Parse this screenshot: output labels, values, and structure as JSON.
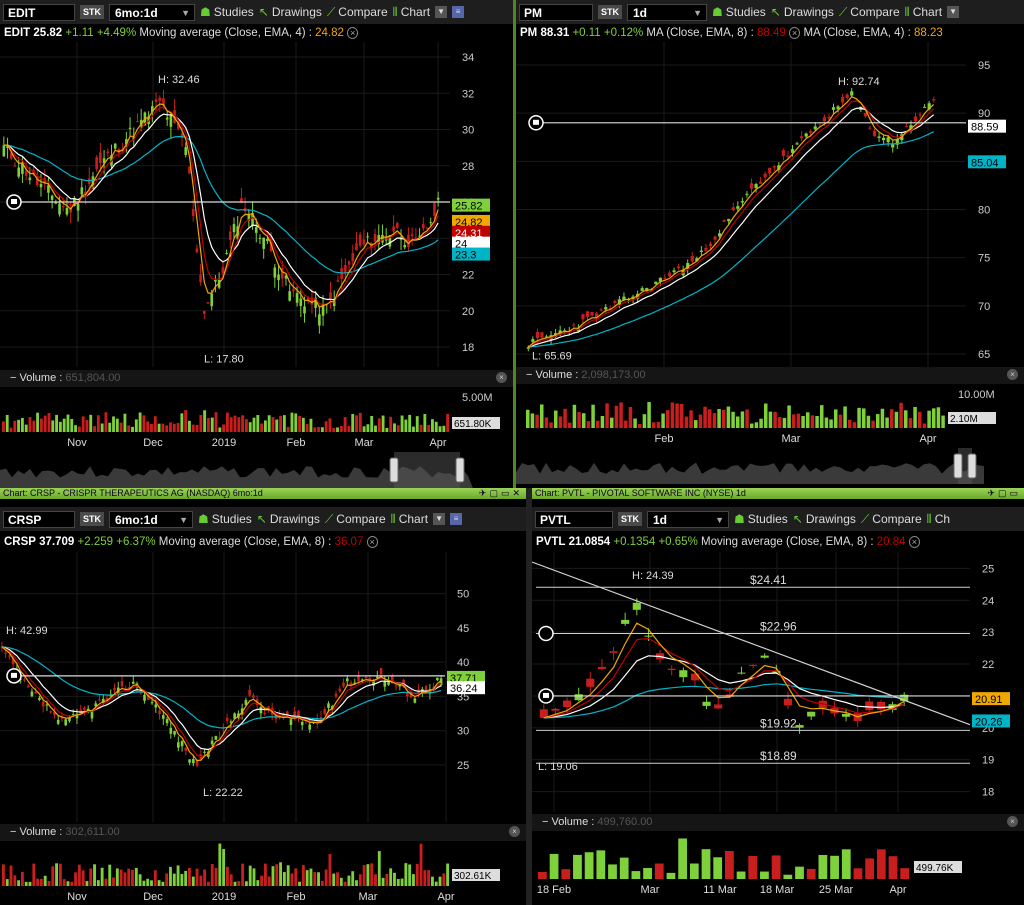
{
  "toolbar_labels": {
    "studies": "Studies",
    "drawings": "Drawings",
    "compare": "Compare",
    "chart": "Chart",
    "chart_short": "Ch",
    "stk": "STK",
    "volume": "Volume"
  },
  "panes": [
    {
      "symbol": "EDIT",
      "period": "6mo:1d",
      "title": "",
      "info": {
        "symbol": "EDIT",
        "price": "25.82",
        "change": "+1.11",
        "pct": "+4.49%",
        "study": "Moving average (Close, EMA, 4) :",
        "study_val": "24.82"
      },
      "yticks": [
        "34",
        "32",
        "30",
        "28",
        "26",
        "24",
        "22",
        "20",
        "18"
      ],
      "xticks": [
        "Nov",
        "Dec",
        "2019",
        "Feb",
        "Mar",
        "Apr"
      ],
      "high_label": "H: 32.46",
      "low_label": "L: 17.80",
      "price_tags": [
        {
          "text": "25.82",
          "color": "#7fd13b",
          "fg": "#000"
        },
        {
          "text": "24.82",
          "color": "#f0a800",
          "fg": "#000"
        },
        {
          "text": "24.31",
          "color": "#c00000",
          "fg": "#fff"
        },
        {
          "text": "24",
          "color": "#ffffff",
          "fg": "#000"
        },
        {
          "text": "23.3",
          "color": "#00b4c8",
          "fg": "#000"
        }
      ],
      "volume_value": "651,804.00",
      "vol_ticks": [
        "5.00M"
      ],
      "vol_tag": "651.80K"
    },
    {
      "symbol": "PM",
      "period": "1d",
      "title": "",
      "info": {
        "symbol": "PM",
        "price": "88.31",
        "change": "+0.11",
        "pct": "+0.12%",
        "study": "MA (Close, EMA, 8) :",
        "study_val": "88.49",
        "study2": "MA (Close, EMA, 4) :",
        "study2_val": "88.23"
      },
      "yticks": [
        "95",
        "90",
        "85",
        "80",
        "75",
        "70",
        "65"
      ],
      "xticks": [
        "Feb",
        "Mar",
        "Apr"
      ],
      "high_label": "H: 92.74",
      "low_label": "L: 65.69",
      "price_tags": [
        {
          "text": "88.59",
          "color": "#ffffff",
          "fg": "#000"
        },
        {
          "text": "85.04",
          "color": "#00b4c8",
          "fg": "#000"
        }
      ],
      "volume_value": "2,098,173.00",
      "vol_ticks": [
        "10.00M"
      ],
      "vol_tag": "2.10M"
    },
    {
      "symbol": "CRSP",
      "period": "6mo:1d",
      "title": "Chart: CRSP - CRISPR THERAPEUTICS AG (NASDAQ) 6mo:1d",
      "info": {
        "symbol": "CRSP",
        "price": "37.709",
        "change": "+2.259",
        "pct": "+6.37%",
        "study": "Moving average (Close, EMA, 8) :",
        "study_val": "36.07"
      },
      "yticks": [
        "50",
        "45",
        "40",
        "35",
        "30",
        "25"
      ],
      "xticks": [
        "Nov",
        "Dec",
        "2019",
        "Feb",
        "Mar",
        "Apr"
      ],
      "high_label": "H: 42.99",
      "low_label": "L: 22.22",
      "price_tags": [
        {
          "text": "37.71",
          "color": "#7fd13b",
          "fg": "#000"
        },
        {
          "text": "36.24",
          "color": "#ffffff",
          "fg": "#000"
        }
      ],
      "volume_value": "302,611.00",
      "vol_ticks": [],
      "vol_tag": "302.61K"
    },
    {
      "symbol": "PVTL",
      "period": "1d",
      "title": "Chart: PVTL - PIVOTAL SOFTWARE INC (NYSE) 1d",
      "info": {
        "symbol": "PVTL",
        "price": "21.0854",
        "change": "+0.1354",
        "pct": "+0.65%",
        "study": "Moving average (Close, EMA, 8) :",
        "study_val": "20.84"
      },
      "yticks": [
        "25",
        "24",
        "23",
        "22",
        "21",
        "20",
        "19",
        "18"
      ],
      "xticks": [
        "18 Feb",
        "Mar",
        "11 Mar",
        "18 Mar",
        "25 Mar",
        "Apr"
      ],
      "high_label": "H: 24.39",
      "low_label": "L: 19.06",
      "levels": [
        "$24.41",
        "$22.96",
        "$19.92",
        "$18.89"
      ],
      "price_tags": [
        {
          "text": "20.91",
          "color": "#f0a800",
          "fg": "#000"
        },
        {
          "text": "20.26",
          "color": "#00b4c8",
          "fg": "#000"
        }
      ],
      "volume_value": "499,760.00",
      "vol_ticks": [],
      "vol_tag": "499.76K"
    }
  ],
  "colors": {
    "up": "#7fd13b",
    "down": "#c81e1e",
    "ema_fast": "#f0a800",
    "ema_white": "#ffffff",
    "ema_slow": "#00b4c8",
    "ema_red": "#c00000"
  }
}
